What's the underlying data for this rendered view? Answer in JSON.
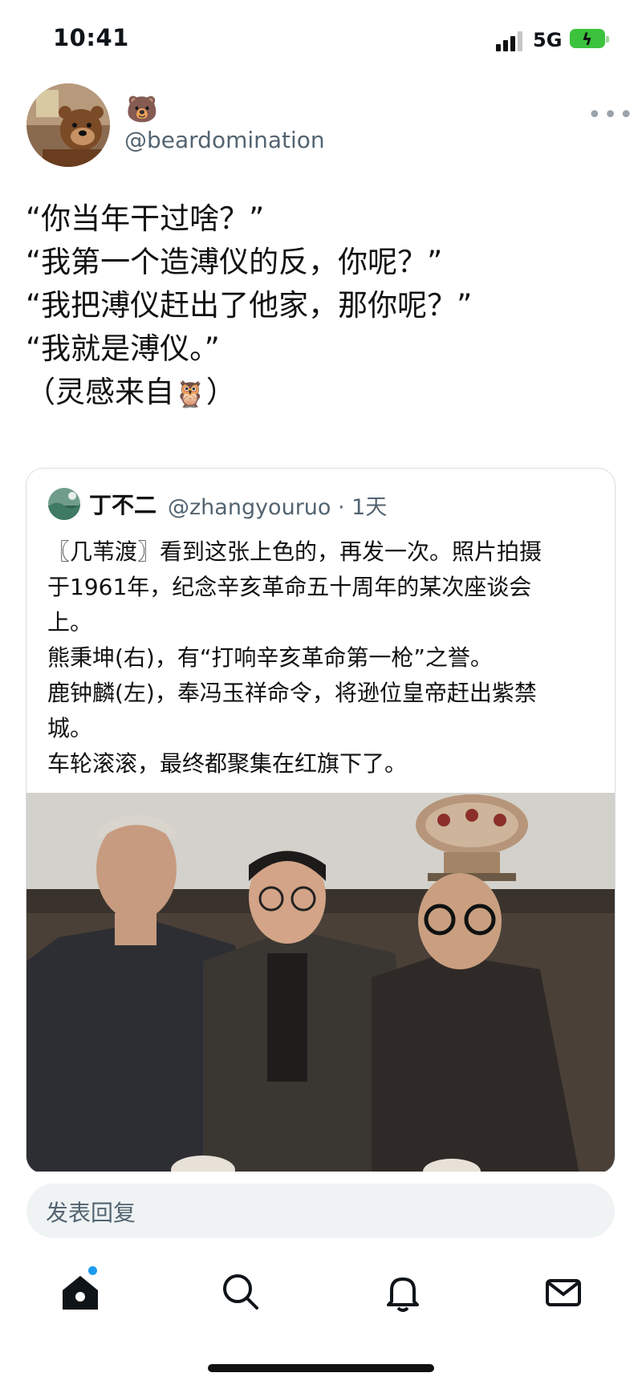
{
  "status_bar": {
    "time": "10:41",
    "network": "5G",
    "battery_icon": "battery-charging-icon",
    "signal_icon": "signal-bars-icon"
  },
  "tweet": {
    "author_emoji": "🐻",
    "handle": "@beardomination",
    "more_icon": "more-dots-icon",
    "lines": [
      "“你当年干过啥？”",
      "“我第一个造溥仪的反，你呢？”",
      "“我把溥仪赶出了他家，那你呢？”",
      "“我就是溥仪。”",
      "（灵感来自"
    ],
    "line5_emoji": "🦉",
    "line5_end": "）"
  },
  "quoted": {
    "name": "丁不二",
    "handle": "@zhangyouruo · 1天",
    "lines": [
      "〖几苇渡〗看到这张上色的，再发一次。照片拍摄",
      "于1961年，纪念辛亥革命五十周年的某次座谈会",
      "上。",
      "熊秉坤(右)，有“打响辛亥革命第一枪”之誉。",
      "鹿钟麟(左)，奉冯玉祥命令，将逊位皇帝赶出紫禁",
      "城。",
      "车轮滚滚，最终都聚集在红旗下了。"
    ]
  },
  "reply": {
    "placeholder": "发表回复"
  },
  "tabbar": {
    "icons": [
      "home-icon",
      "search-icon",
      "notifications-icon",
      "messages-icon"
    ],
    "accent": "#1d9bf0"
  }
}
